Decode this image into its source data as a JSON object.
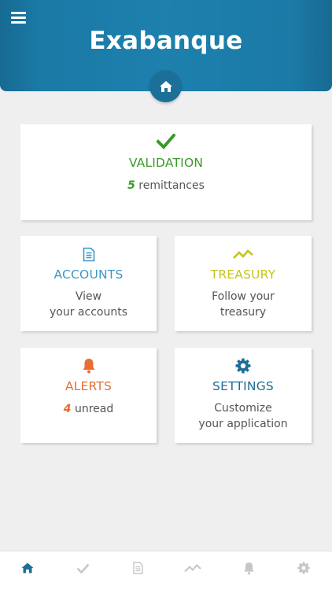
{
  "header": {
    "title": "Exabanque"
  },
  "colors": {
    "brand": "#1b7aa6",
    "validation": "#3a9a2a",
    "accounts": "#3d97c4",
    "treasury": "#c5c51a",
    "alerts": "#e86e30",
    "settings": "#1e6d98"
  },
  "validation": {
    "title": "VALIDATION",
    "count": "5",
    "count_suffix": "remittances"
  },
  "accounts": {
    "title": "ACCOUNTS",
    "line1": "View",
    "line2": "your accounts"
  },
  "treasury": {
    "title": "TREASURY",
    "line1": "Follow your",
    "line2": "treasury"
  },
  "alerts": {
    "title": "ALERTS",
    "count": "4",
    "count_suffix": "unread"
  },
  "settings": {
    "title": "SETTINGS",
    "line1": "Customize",
    "line2": "your application"
  },
  "bottom_nav": {
    "items": [
      "home-icon",
      "check-icon",
      "document-icon",
      "chart-icon",
      "bell-icon",
      "gear-icon"
    ],
    "active": "home-icon"
  }
}
